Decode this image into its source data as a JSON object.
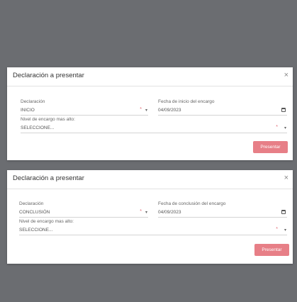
{
  "modals": [
    {
      "title": "Declaración a presentar",
      "close_glyph": "×",
      "declaracion_label": "Declaración",
      "declaracion_value": "INICIO",
      "fecha_label": "Fecha de inicio del encargo",
      "fecha_value": "04/09/2023",
      "nivel_label": "Nivel de encargo mas alto:",
      "nivel_value": "SELECCIONE...",
      "required_mark": "*",
      "submit_label": "Presentar"
    },
    {
      "title": "Declaración a presentar",
      "close_glyph": "×",
      "declaracion_label": "Declaración",
      "declaracion_value": "CONCLUSIÓN",
      "fecha_label": "Fecha de conclusión del encargo",
      "fecha_value": "04/09/2023",
      "nivel_label": "Nivel de encargo mas alto:",
      "nivel_value": "SELECCIONE...",
      "required_mark": "*",
      "submit_label": "Presentar"
    }
  ],
  "colors": {
    "backdrop": "#6b6d71",
    "primary_button": "#e77f87",
    "required": "#e06a75"
  },
  "icons": {
    "dropdown": "chevron-down-icon",
    "date": "calendar-icon",
    "close": "close-icon"
  }
}
